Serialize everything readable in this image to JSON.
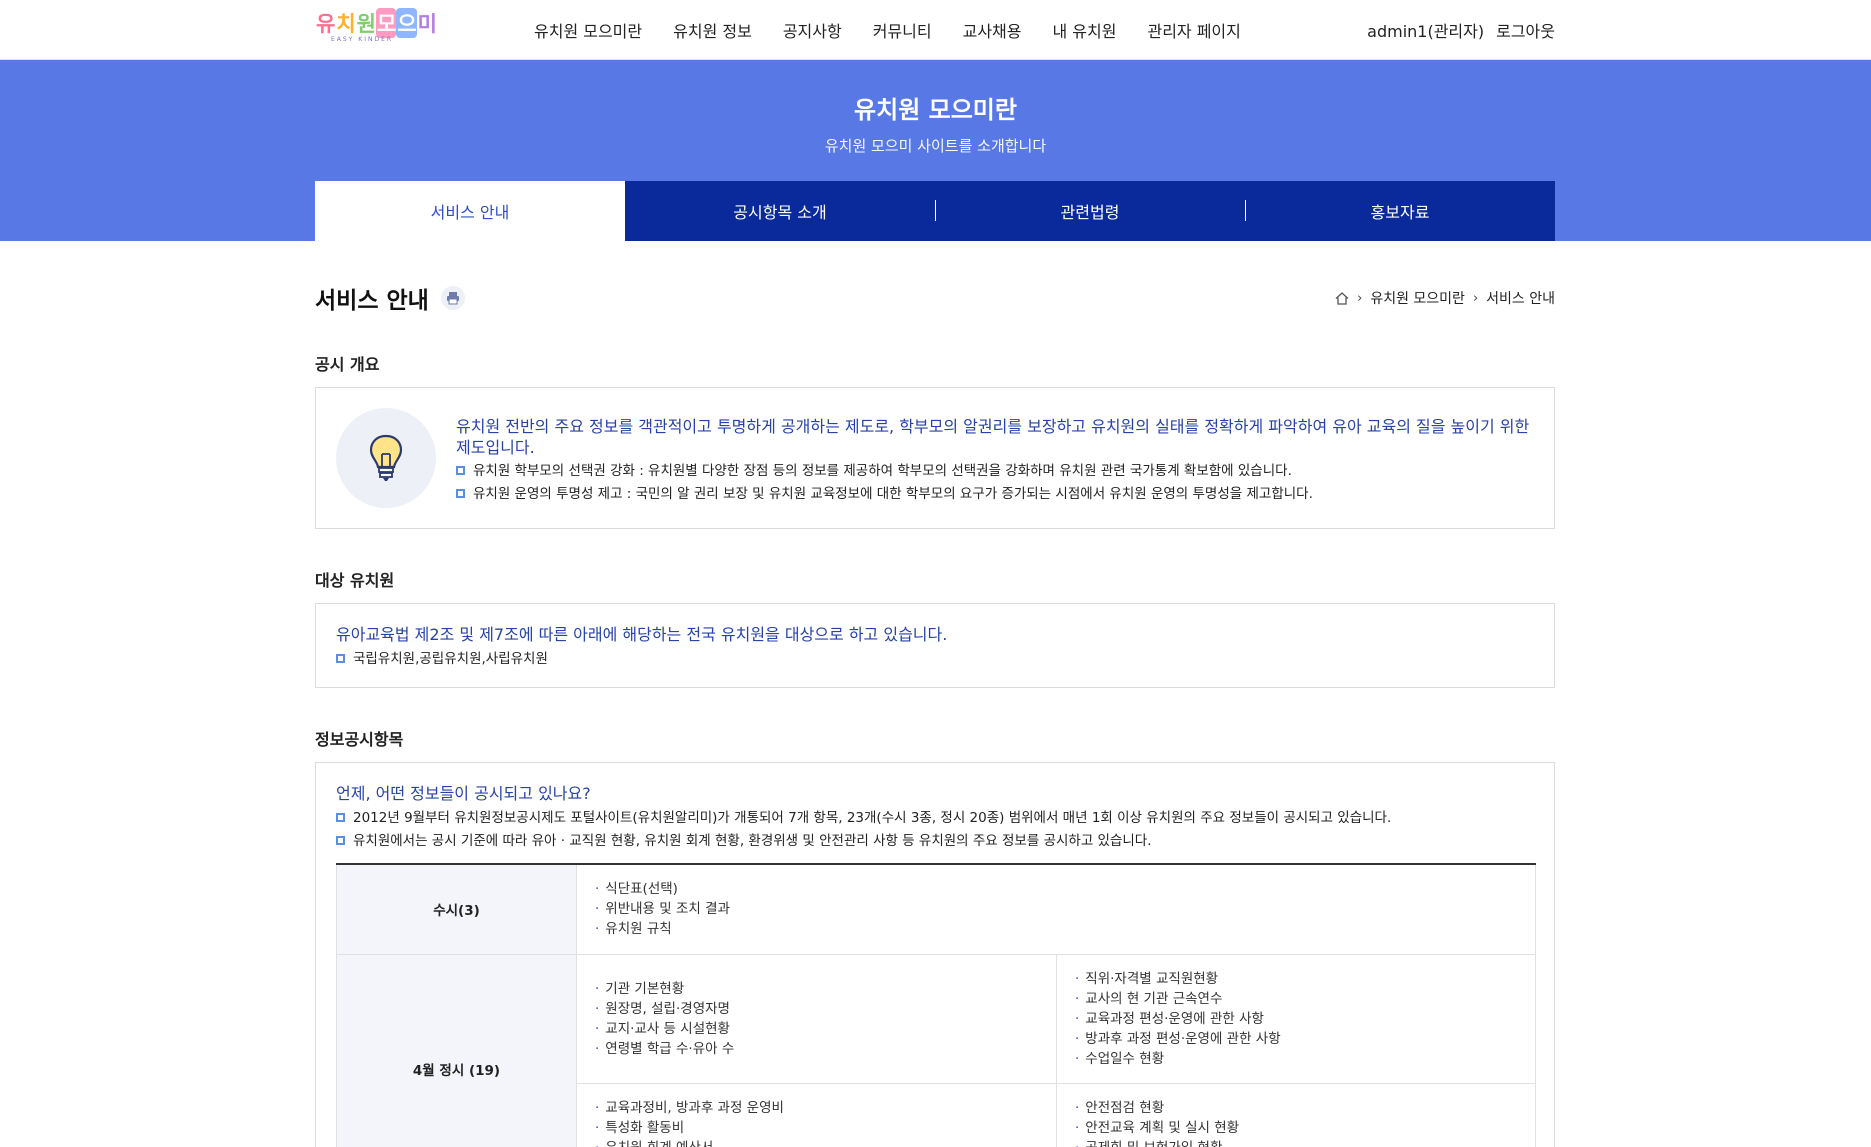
{
  "header": {
    "logo_text": [
      "유",
      "치",
      "원",
      "모",
      "으",
      "미"
    ],
    "logo_sub": "EASY KINDER",
    "nav": [
      "유치원 모으미란",
      "유치원 정보",
      "공지사항",
      "커뮤니티",
      "교사채용",
      "내 유치원",
      "관리자 페이지"
    ],
    "user": "admin1(관리자)",
    "logout": "로그아웃"
  },
  "hero": {
    "title": "유치원 모으미란",
    "subtitle": "유치원 모으미 사이트를 소개합니다"
  },
  "tabs": [
    "서비스 안내",
    "공시항목 소개",
    "관련법령",
    "홍보자료"
  ],
  "page": {
    "title": "서비스 안내",
    "breadcrumb": [
      "유치원 모으미란",
      "서비스 안내"
    ]
  },
  "overview": {
    "title": "공시 개요",
    "lead": "유치원 전반의 주요 정보를 객관적이고 투명하게 공개하는 제도로, 학부모의 알권리를 보장하고 유치원의 실태를 정확하게 파악하여 유아 교육의 질을 높이기 위한 제도입니다.",
    "bullets": [
      "유치원 학부모의 선택권 강화 : 유치원별 다양한 장점 등의 정보를 제공하여 학부모의 선택권을 강화하며 유치원 관련 국가통계 확보함에 있습니다.",
      "유치원 운영의 투명성 제고 : 국민의 알 권리 보장 및 유치원 교육정보에 대한 학부모의 요구가 증가되는 시점에서 유치원 운영의 투명성을 제고합니다."
    ]
  },
  "target": {
    "title": "대상 유치원",
    "lead": "유아교육법 제2조 및 제7조에 따른 아래에 해당하는 전국 유치원을 대상으로 하고 있습니다.",
    "bullets": [
      "국립유치원,공립유치원,사립유치원"
    ]
  },
  "items": {
    "title": "정보공시항목",
    "lead": "언제, 어떤 정보들이 공시되고 있나요?",
    "bullets": [
      "2012년 9월부터 유치원정보공시제도 포털사이트(유치원알리미)가 개통되어 7개 항목, 23개(수시 3종, 정시 20종) 범위에서 매년 1회 이상 유치원의 주요 정보들이 공시되고 있습니다.",
      "유치원에서는 공시 기준에 따라 유아 · 교직원 현황, 유치원 회계 현황, 환경위생 및 안전관리 사항 등 유치원의 주요 정보를 공시하고 있습니다."
    ],
    "table": {
      "row1_head": "수시(3)",
      "row1_items": [
        "식단표(선택)",
        "위반내용 및 조치 결과",
        "유치원 규칙"
      ],
      "row2_head": "4월 정시 (19)",
      "row2_left": [
        "기관 기본현황",
        "원장명, 설립·경영자명",
        "교지·교사 등 시설현황",
        "연령별 학급 수·유아 수"
      ],
      "row2_right": [
        "직위·자격별 교직원현황",
        "교사의 현 기관 근속연수",
        "교육과정 편성·운영에 관한 사항",
        "방과후 과정 편성·운영에 관한 사항",
        "수업일수 현황"
      ],
      "row3_left": [
        "교육과정비, 방과후 과정 운영비",
        "특성화 활동비",
        "유치원 회계 예산서"
      ],
      "row3_right": [
        "안전점검 현황",
        "안전교육 계획 및 실시 현황",
        "공제회 및 보험가입 현황"
      ]
    }
  },
  "colors": {
    "hero_bg": "#5878e6",
    "tab_bg": "#0a2a9c",
    "lead_text": "#2842a8"
  }
}
